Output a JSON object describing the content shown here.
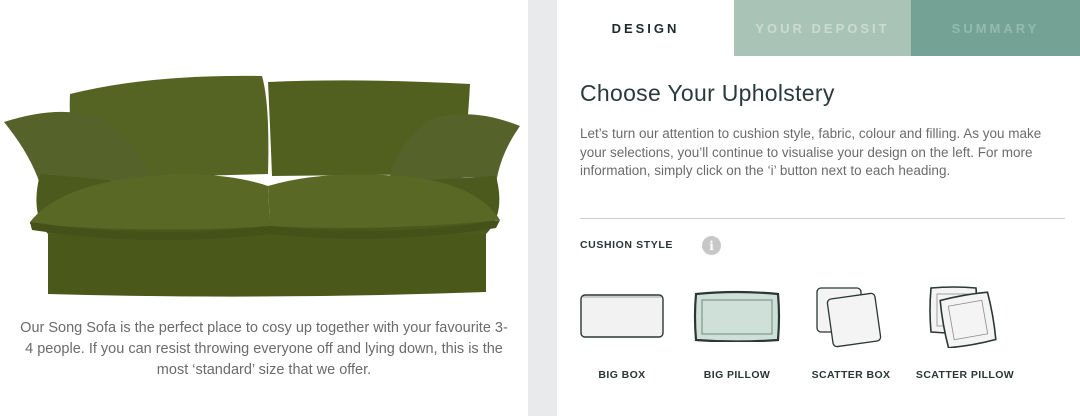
{
  "product": {
    "image_alt": "Song Sofa in olive green linen",
    "caption": "Our Song Sofa is the perfect place to cosy up together with your favourite 3-4 people. If you can resist throwing everyone off and lying down, this is the most ‘standard’ size that we offer.",
    "sofa_color": "#4f5d1c"
  },
  "tabs": [
    {
      "label": "DESIGN",
      "state": "active"
    },
    {
      "label": "YOUR DEPOSIT",
      "state": "inactive"
    },
    {
      "label": "SUMMARY",
      "state": "inactive"
    }
  ],
  "main": {
    "heading": "Choose Your Upholstery",
    "intro": "Let’s turn our attention to cushion style, fabric, colour and filling. As you make your selections, you’ll continue to visualise your design on the left. For more information, simply click on the ‘i’ button next to each heading."
  },
  "cushion_style": {
    "label": "CUSHION STYLE",
    "info_icon": "i",
    "options": [
      {
        "label": "BIG BOX",
        "icon": "big-box-icon"
      },
      {
        "label": "BIG PILLOW",
        "icon": "big-pillow-icon",
        "selected": true
      },
      {
        "label": "SCATTER BOX",
        "icon": "scatter-box-icon"
      },
      {
        "label": "SCATTER PILLOW",
        "icon": "scatter-pillow-icon"
      }
    ]
  },
  "colors": {
    "tab_deposit_bg": "#a9c4b7",
    "tab_summary_bg": "#74a396",
    "selected_fill": "#cfe0d8",
    "outline": "#2b3636"
  }
}
